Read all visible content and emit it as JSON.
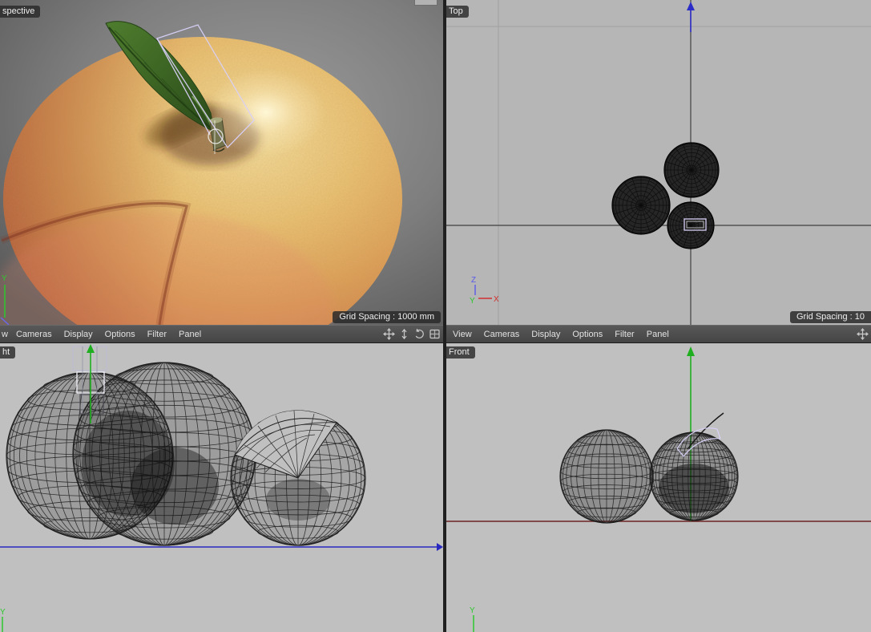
{
  "viewports": {
    "perspective": {
      "label": "spective",
      "grid_spacing": "Grid Spacing : 1000 mm",
      "axis_y": "Y"
    },
    "top": {
      "label": "Top",
      "grid_spacing": "Grid Spacing : 10",
      "axis_z": "Z",
      "axis_y": "Y",
      "axis_x": "X"
    },
    "right_side": {
      "label": "ht",
      "axis_y": "Y"
    },
    "front": {
      "label": "Front",
      "axis_y": "Y"
    }
  },
  "menus": {
    "left": {
      "items": [
        "w",
        "Cameras",
        "Display",
        "Options",
        "Filter",
        "Panel"
      ]
    },
    "right": {
      "items": [
        "View",
        "Cameras",
        "Display",
        "Options",
        "Filter",
        "Panel"
      ]
    }
  },
  "view_controls": {
    "move": "move-view",
    "zoom": "zoom-view",
    "rotate": "rotate-view",
    "toggle": "toggle-active-view"
  },
  "colors": {
    "axis_x": "#d03030",
    "axis_y": "#1fae1f",
    "axis_z": "#2c2cc8",
    "selection": "#d9d0f8",
    "ground": "#6e2424",
    "grid_dark": "#404040",
    "grid_light": "#a0a0a0",
    "menubar_bg": "#4b4b4b"
  }
}
